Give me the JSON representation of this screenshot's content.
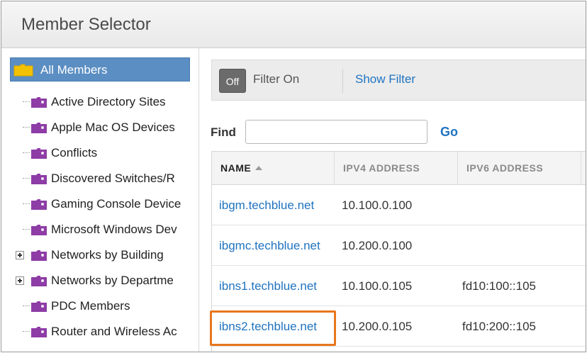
{
  "window": {
    "title": "Member Selector"
  },
  "tree": {
    "root": {
      "label": "All Members",
      "icon": "folder-icon"
    },
    "items": [
      {
        "label": "Active Directory Sites",
        "expandable": false
      },
      {
        "label": "Apple Mac OS Devices",
        "expandable": false
      },
      {
        "label": "Conflicts",
        "expandable": false
      },
      {
        "label": "Discovered Switches/R",
        "expandable": false
      },
      {
        "label": "Gaming Console Device",
        "expandable": false
      },
      {
        "label": "Microsoft Windows Dev",
        "expandable": false
      },
      {
        "label": "Networks by Building",
        "expandable": true
      },
      {
        "label": "Networks by Departme",
        "expandable": true
      },
      {
        "label": "PDC Members",
        "expandable": false
      },
      {
        "label": "Router and Wireless Ac",
        "expandable": false
      }
    ]
  },
  "filter": {
    "toggle_label": "Off",
    "status_label": "Filter On",
    "show_filter_label": "Show Filter"
  },
  "find": {
    "label": "Find",
    "value": "",
    "placeholder": "",
    "go_label": "Go"
  },
  "grid": {
    "columns": [
      {
        "label": "NAME",
        "sorted": "asc"
      },
      {
        "label": "IPV4 ADDRESS"
      },
      {
        "label": "IPV6 ADDRESS"
      }
    ],
    "rows": [
      {
        "name": "ibgm.techblue.net",
        "ipv4": "10.100.0.100",
        "ipv6": ""
      },
      {
        "name": "ibgmc.techblue.net",
        "ipv4": "10.200.0.100",
        "ipv6": ""
      },
      {
        "name": "ibns1.techblue.net",
        "ipv4": "10.100.0.105",
        "ipv6": "fd10:100::105"
      },
      {
        "name": "ibns2.techblue.net",
        "ipv4": "10.200.0.105",
        "ipv6": "fd10:200::105"
      }
    ]
  },
  "colors": {
    "accent": "#1f73c0",
    "selection": "#5b8ec2",
    "highlight": "#e8771d",
    "folder": "#f2c200",
    "group_icon": "#8e3ca6"
  }
}
